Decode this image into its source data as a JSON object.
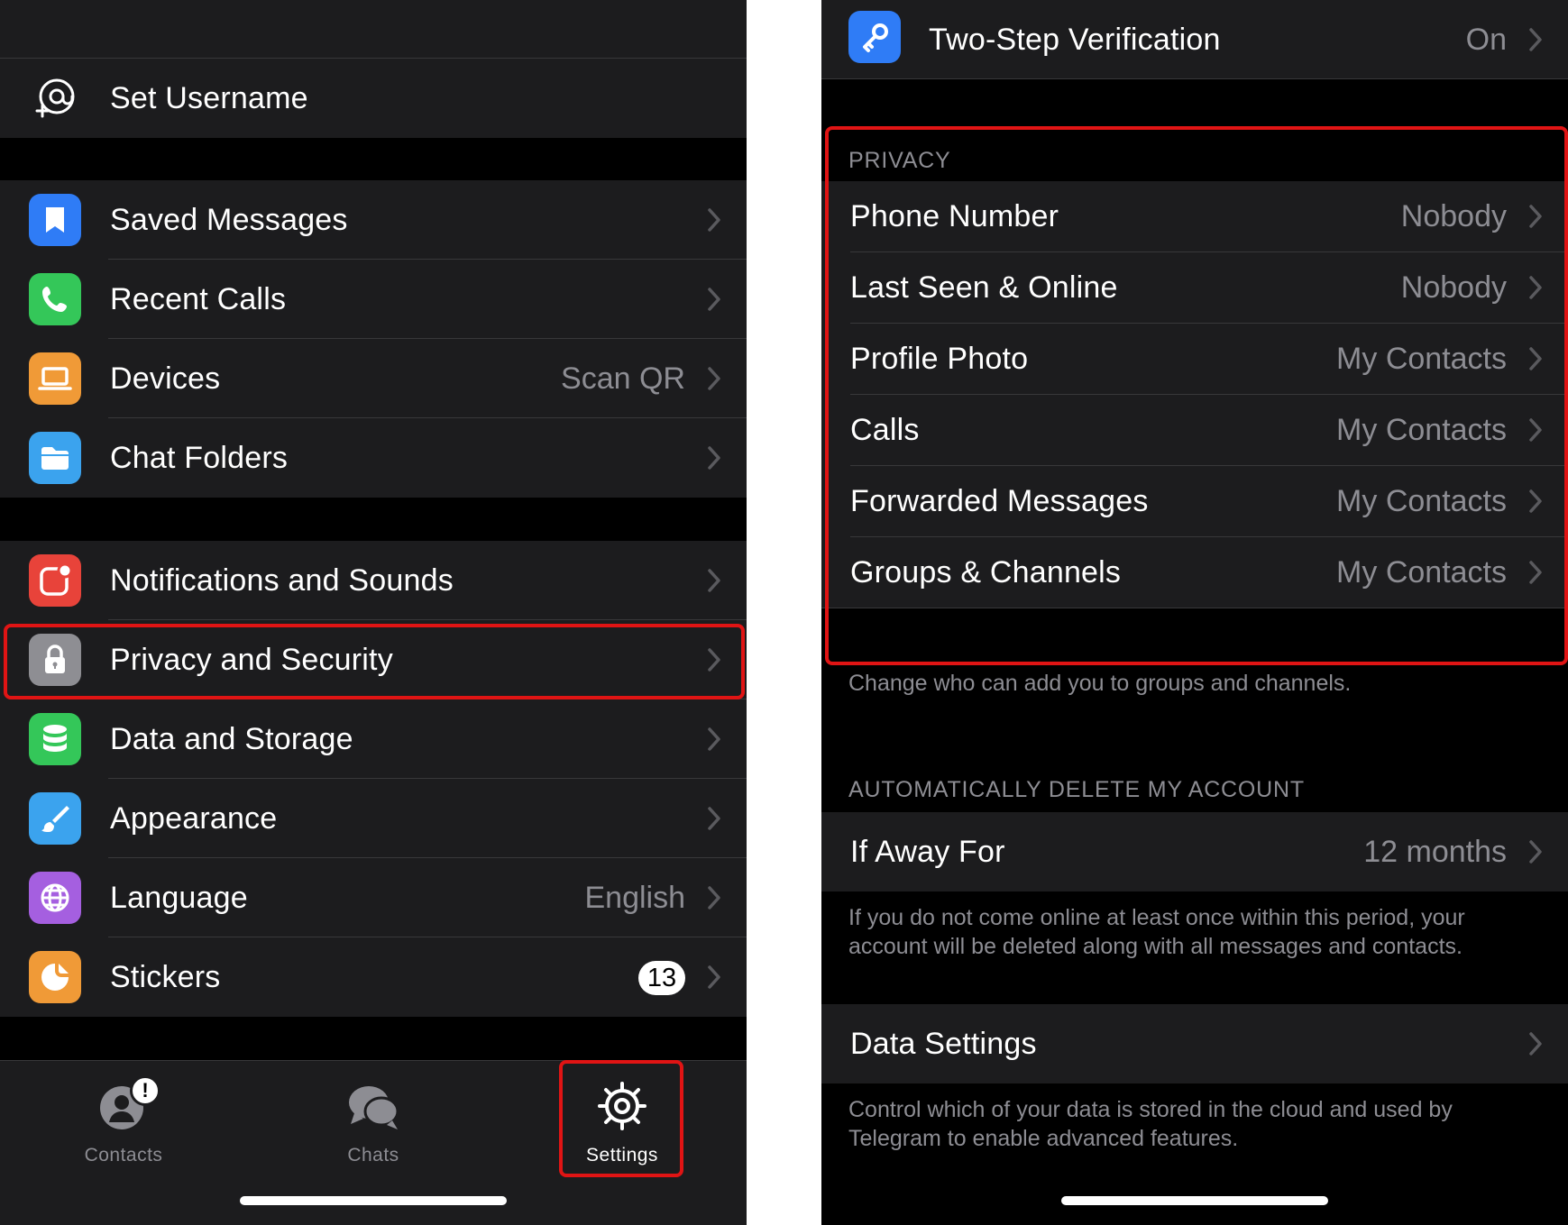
{
  "left": {
    "set_username": "Set Username",
    "group1": [
      {
        "label": "Saved Messages",
        "icon": "bookmark-icon",
        "color": "#2f7cf6"
      },
      {
        "label": "Recent Calls",
        "icon": "phone-icon",
        "color": "#34c759"
      },
      {
        "label": "Devices",
        "icon": "laptop-icon",
        "color": "#f09a37",
        "value": "Scan QR"
      },
      {
        "label": "Chat Folders",
        "icon": "folder-icon",
        "color": "#3ba3ee"
      }
    ],
    "group2": [
      {
        "label": "Notifications and Sounds",
        "icon": "notification-icon",
        "color": "#e8433a"
      },
      {
        "label": "Privacy and Security",
        "icon": "lock-icon",
        "color": "#8e8e93"
      },
      {
        "label": "Data and Storage",
        "icon": "database-icon",
        "color": "#34c759"
      },
      {
        "label": "Appearance",
        "icon": "brush-icon",
        "color": "#3ba3ee"
      },
      {
        "label": "Language",
        "icon": "globe-icon",
        "color": "#a55fe0",
        "value": "English"
      },
      {
        "label": "Stickers",
        "icon": "sticker-icon",
        "color": "#f09a37",
        "badge": "13"
      }
    ],
    "tabs": [
      {
        "label": "Contacts",
        "icon": "contacts-icon"
      },
      {
        "label": "Chats",
        "icon": "chats-icon"
      },
      {
        "label": "Settings",
        "icon": "settings-gear-icon"
      }
    ],
    "highlight_color": "#e01414"
  },
  "right": {
    "two_step": {
      "label": "Two-Step Verification",
      "value": "On"
    },
    "privacy_header": "PRIVACY",
    "privacy_items": [
      {
        "label": "Phone Number",
        "value": "Nobody"
      },
      {
        "label": "Last Seen & Online",
        "value": "Nobody"
      },
      {
        "label": "Profile Photo",
        "value": "My Contacts"
      },
      {
        "label": "Calls",
        "value": "My Contacts"
      },
      {
        "label": "Forwarded Messages",
        "value": "My Contacts"
      },
      {
        "label": "Groups & Channels",
        "value": "My Contacts"
      }
    ],
    "groups_note": "Change who can add you to groups and channels.",
    "delete_header": "AUTOMATICALLY DELETE MY ACCOUNT",
    "if_away": {
      "label": "If Away For",
      "value": "12 months"
    },
    "away_note": "If you do not come online at least once within this period, your account will be deleted along with all messages and contacts.",
    "data_settings": "Data Settings",
    "data_note": "Control which of your data is stored in the cloud and used by Telegram to enable advanced features."
  }
}
